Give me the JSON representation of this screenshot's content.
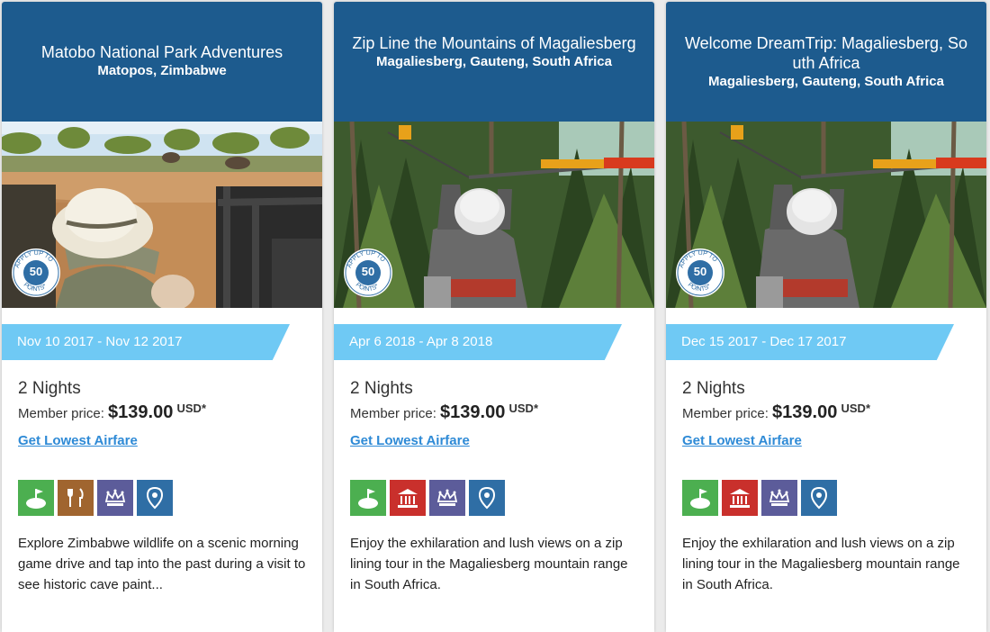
{
  "colors": {
    "header": "#1d5b8e",
    "ribbon": "#6fc9f4",
    "link": "#2e8ad6",
    "golf": "#4caf50",
    "dining": "#a0652f",
    "museum": "#c9302c",
    "vip": "#5c5c9a",
    "location": "#2f6ea5"
  },
  "cards": [
    {
      "title": "Matobo National Park Adventures",
      "location": "Matopos, Zimbabwe",
      "photo": "safari-game-drive",
      "points_badge": {
        "arc_text": "APPLY UP TO POINTS*",
        "value": "50"
      },
      "dates": "Nov 10 2017 - Nov 12 2017",
      "nights": "2 Nights",
      "price_label": "Member price:",
      "price": "$139.00",
      "currency": "USD*",
      "airfare_link": "Get Lowest Airfare",
      "amenities": [
        "golf-icon",
        "dining-icon",
        "vip-crown-icon",
        "location-pin-icon"
      ],
      "description": "Explore Zimbabwe wildlife on a scenic morning game drive and tap into the past during a visit to see historic cave paint..."
    },
    {
      "title": "Zip Line the Mountains of Magaliesberg",
      "location": "Magaliesberg, Gauteng, South Africa",
      "photo": "zip-line-forest",
      "points_badge": {
        "arc_text": "APPLY UP TO POINTS*",
        "value": "50"
      },
      "dates": "Apr 6 2018 - Apr 8 2018",
      "nights": "2 Nights",
      "price_label": "Member price:",
      "price": "$139.00",
      "currency": "USD*",
      "airfare_link": "Get Lowest Airfare",
      "amenities": [
        "golf-icon",
        "museum-icon",
        "vip-crown-icon",
        "location-pin-icon"
      ],
      "description": "Enjoy the exhilaration and lush views on a zip lining tour in the Magaliesberg mountain range in South Africa."
    },
    {
      "title": "Welcome DreamTrip: Magaliesberg, South Africa",
      "location": "Magaliesberg, Gauteng, South Africa",
      "photo": "zip-line-forest",
      "points_badge": {
        "arc_text": "APPLY UP TO POINTS*",
        "value": "50"
      },
      "dates": "Dec 15 2017 - Dec 17 2017",
      "nights": "2 Nights",
      "price_label": "Member price:",
      "price": "$139.00",
      "currency": "USD*",
      "airfare_link": "Get Lowest Airfare",
      "amenities": [
        "golf-icon",
        "museum-icon",
        "vip-crown-icon",
        "location-pin-icon"
      ],
      "description": "Enjoy the exhilaration and lush views on a zip lining tour in the Magaliesberg mountain range in South Africa."
    }
  ]
}
